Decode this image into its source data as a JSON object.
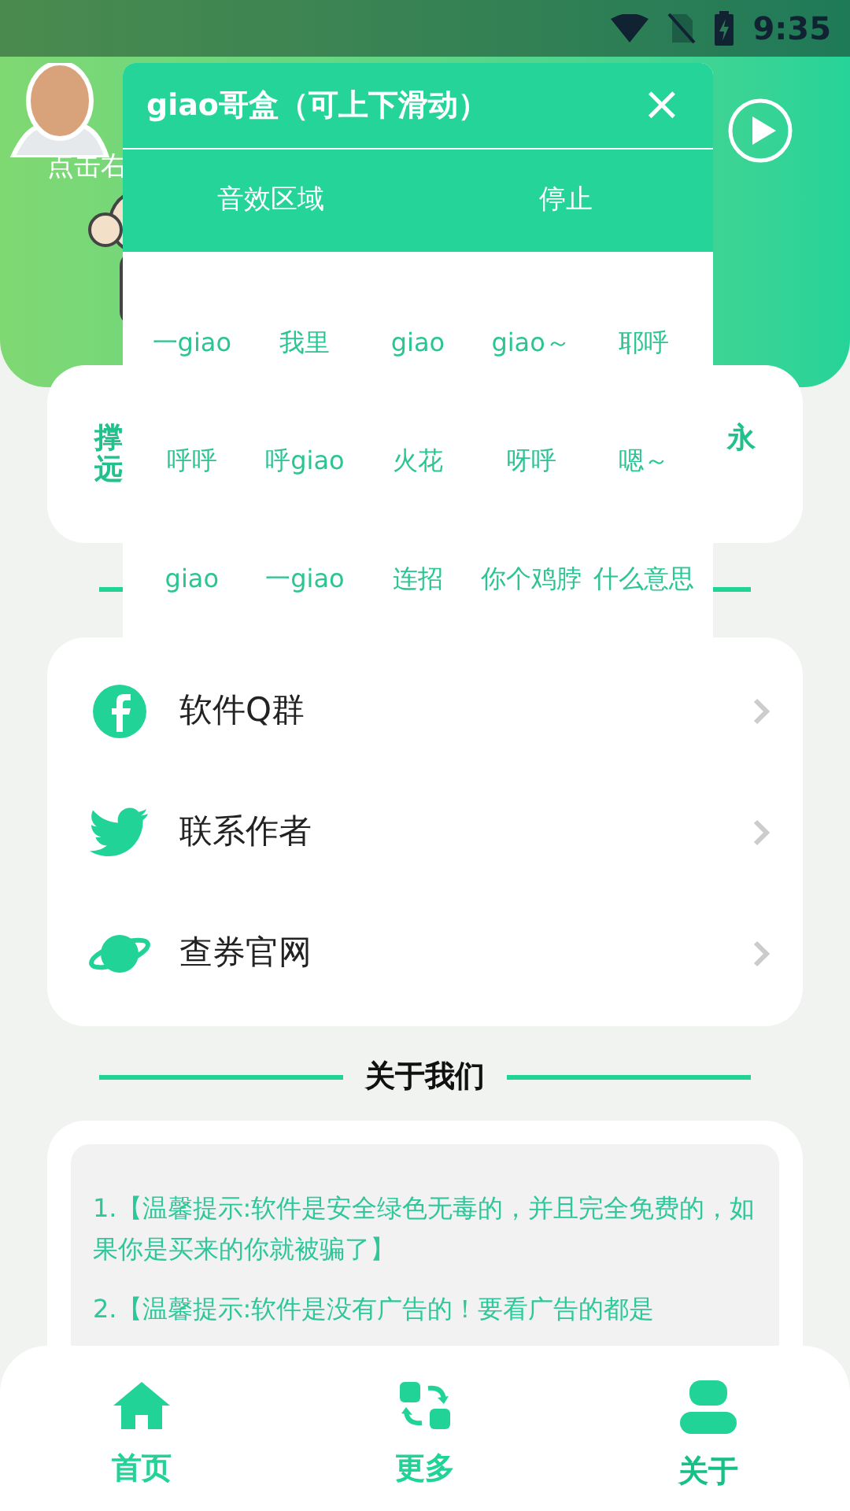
{
  "status_bar": {
    "time": "9:35"
  },
  "header": {
    "subtitle": "点击右"
  },
  "notice": {
    "left": "撑远",
    "right": "永"
  },
  "dialog": {
    "title": "giao哥盒（可上下滑动）",
    "close": "×",
    "tabs": [
      "音效区域",
      "停止"
    ],
    "sounds": [
      "一giao",
      "我里",
      "giao",
      "giao～",
      "耶呼",
      "呼呼",
      "呼giao",
      "火花",
      "呀呼",
      "嗯～",
      "giao",
      "一giao",
      "连招",
      "你个鸡脖",
      "什么意思"
    ]
  },
  "links": [
    {
      "kind": "facebook",
      "label": "软件Q群"
    },
    {
      "kind": "bird",
      "label": "联系作者"
    },
    {
      "kind": "planet",
      "label": "查券官网"
    }
  ],
  "about": {
    "heading": "关于我们",
    "paragraphs": [
      "1.【温馨提示:软件是安全绿色无毒的，并且完全免费的，如果你是买来的你就被骗了】",
      "2.【温馨提示:软件是没有广告的！要看广告的都是"
    ]
  },
  "nav": [
    {
      "kind": "home",
      "label": "首页",
      "selected": false
    },
    {
      "kind": "more",
      "label": "更多",
      "selected": false
    },
    {
      "kind": "user",
      "label": "关于",
      "selected": true
    }
  ]
}
